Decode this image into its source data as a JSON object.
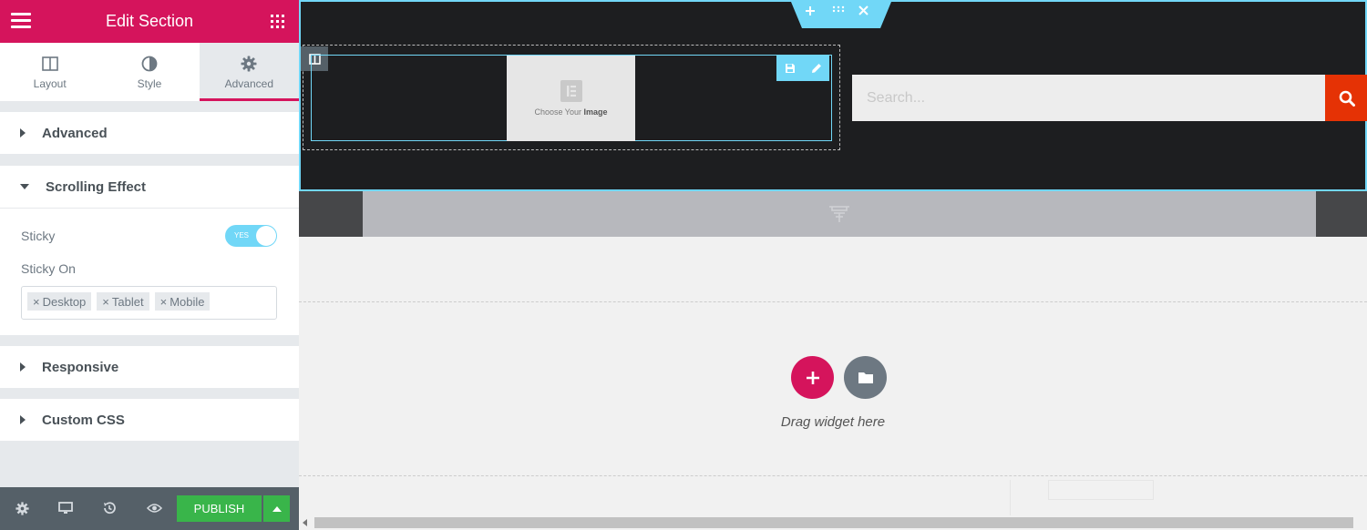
{
  "panel": {
    "title": "Edit Section",
    "tabs": [
      {
        "label": "Layout",
        "icon": "columns-icon"
      },
      {
        "label": "Style",
        "icon": "contrast-icon"
      },
      {
        "label": "Advanced",
        "icon": "gear-icon",
        "active": true
      }
    ],
    "sections": {
      "advanced": {
        "label": "Advanced",
        "expanded": false
      },
      "scrolling_effect": {
        "label": "Scrolling Effect",
        "expanded": true,
        "sticky_label": "Sticky",
        "sticky_toggle": "YES",
        "sticky_on_label": "Sticky On",
        "sticky_on_values": [
          "Desktop",
          "Tablet",
          "Mobile"
        ],
        "remove_symbol": "×"
      },
      "responsive": {
        "label": "Responsive",
        "expanded": false
      },
      "custom_css": {
        "label": "Custom CSS",
        "expanded": false
      }
    },
    "footer": {
      "publish_label": "PUBLISH",
      "icons": [
        "gear-icon",
        "desktop-icon",
        "history-icon",
        "eye-icon",
        "caret-up-icon"
      ]
    }
  },
  "canvas": {
    "image_placeholder": {
      "text": "Choose Your",
      "bold": "Image"
    },
    "search": {
      "placeholder": "Search..."
    },
    "drop_zone": {
      "text": "Drag widget here"
    }
  },
  "colors": {
    "brand": "#d5145c",
    "accent": "#71d7f7",
    "publish": "#39b54a",
    "search_button": "#e53205",
    "dark_section": "#1d1e20"
  }
}
